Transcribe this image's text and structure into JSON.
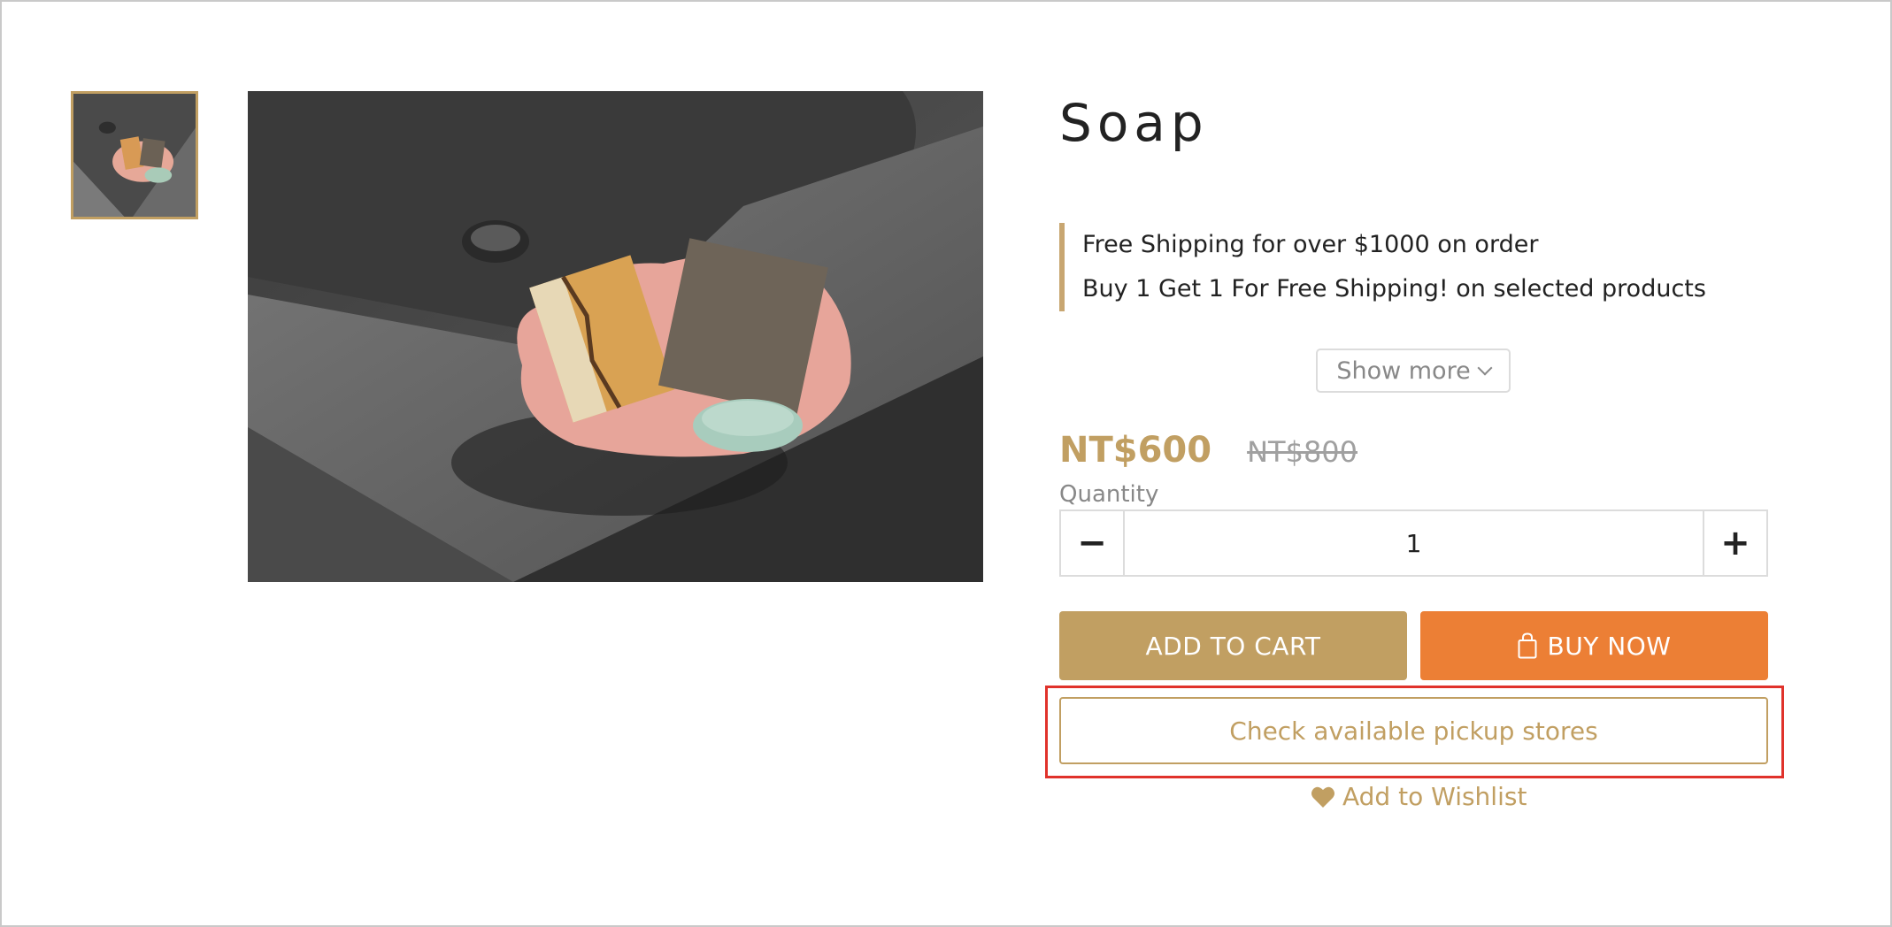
{
  "product": {
    "title": "Soap",
    "thumbnail_alt": "soap-thumbnail",
    "main_image_alt": "soap-main-photo"
  },
  "promotions": [
    "Free Shipping for over $1000 on order",
    "Buy 1 Get 1 For Free Shipping! on selected products"
  ],
  "show_more_label": "Show more",
  "pricing": {
    "price": "NT$600",
    "original_price": "NT$800"
  },
  "quantity": {
    "label": "Quantity",
    "value": "1",
    "minus_symbol": "−",
    "plus_symbol": "+"
  },
  "actions": {
    "add_to_cart": "ADD TO CART",
    "buy_now": "BUY NOW",
    "pickup_stores": "Check available pickup stores",
    "wishlist": "Add to Wishlist"
  },
  "icons": {
    "buy_now": "shopping-bag-icon",
    "wishlist": "heart-icon",
    "show_more": "chevron-down-icon"
  },
  "colors": {
    "accent_gold": "#c19f62",
    "buy_orange": "#ec7f35",
    "highlight_red": "#e0322b",
    "old_price_gray": "#a0a0a0"
  }
}
